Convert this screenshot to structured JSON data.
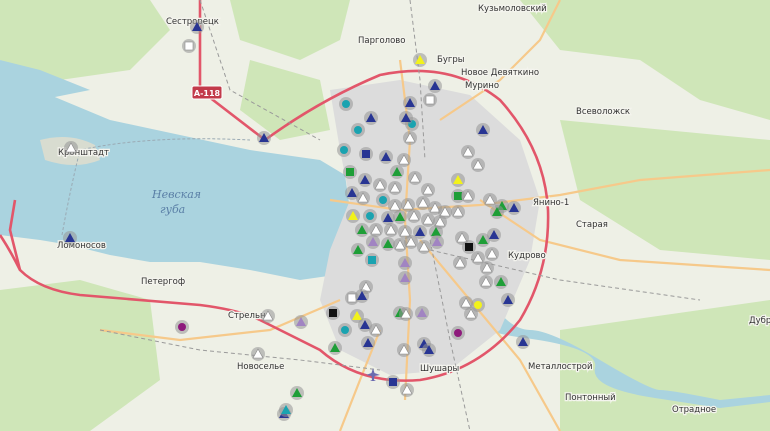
{
  "map": {
    "labels": {
      "sestroretsk": "Сестрорецк",
      "pargolovo": "Парголово",
      "kuzmolovsky": "Кузьмоловский",
      "bugry": "Бугры",
      "novoe_devyatkino": "Новое Девяткино",
      "murino": "Мурино",
      "vsevolozhsk": "Всеволожск",
      "kronstadt": "Кронштадт",
      "nevskaya_guba_1": "Невская",
      "nevskaya_guba_2": "губа",
      "yanino": "Янино-1",
      "staraya": "Старая",
      "lomonosov": "Ломоносов",
      "kudrovo": "Кудрово",
      "petergof": "Петергоф",
      "strelna": "Стрельна",
      "novoselye": "Новоселье",
      "shushary": "Шушары",
      "metallostroy": "Металлострой",
      "pontonny": "Понтонный",
      "otradnoe": "Отрадное",
      "dubrovka": "Дубр"
    },
    "road_shield": "А-118",
    "colors": {
      "land": "#eef0e6",
      "water": "#aad3df",
      "forest": "#cfe6b8",
      "urban": "#dcdcdc",
      "motorway": "#e2566a",
      "primary": "#f6c98a",
      "marker_navy": "#283593",
      "marker_teal": "#1aa3b0",
      "marker_green": "#1e9e37",
      "marker_white": "#ffffff",
      "marker_lilac": "#a184c2",
      "marker_yellow": "#f2f21b",
      "marker_purple": "#8e1a7c",
      "marker_black": "#111111"
    }
  }
}
